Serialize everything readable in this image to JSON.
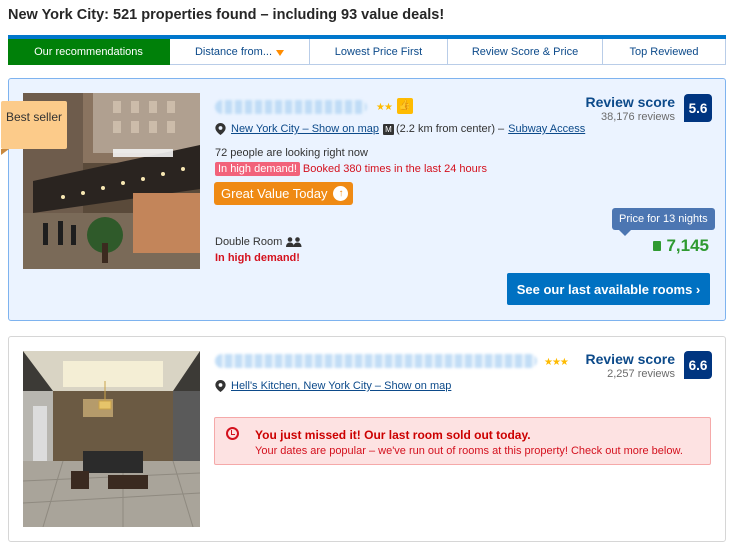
{
  "heading": "New York City: 521 properties found – including 93 value deals!",
  "sort_tabs": [
    {
      "label": "Our recommendations",
      "active": true
    },
    {
      "label": "Distance from...",
      "active": false
    },
    {
      "label": "Lowest Price First",
      "active": false
    },
    {
      "label": "Review Score & Price",
      "active": false
    },
    {
      "label": "Top Reviewed",
      "active": false
    }
  ],
  "hotel1": {
    "badge": "Best seller",
    "stars": "★★",
    "location_link": "New York City – Show on map",
    "distance": "(2.2 km from center) –",
    "subway": "Subway Access",
    "looking": "72 people are looking right now",
    "demand_pill": "In high demand!",
    "booked": "Booked 380 times in the last 24 hours",
    "great_value": "Great Value Today",
    "room_type": "Double Room",
    "room_demand": "In high demand!",
    "review_label": "Review score",
    "review_count": "38,176 reviews",
    "score": "5.6",
    "price_tip": "Price for 13 nights",
    "price": "7,145",
    "cta": "See our last available rooms ›",
    "colors": {
      "card_bg": "#ebf3ff",
      "cta": "#0071c2",
      "price": "#2f9a31"
    }
  },
  "hotel2": {
    "stars": "★★★",
    "location_link": "Hell's Kitchen, New York City – Show on map",
    "review_label": "Review score",
    "review_count": "2,257 reviews",
    "score": "6.6",
    "soldout_title": "You just missed it! Our last room sold out today.",
    "soldout_text": "Your dates are popular – we've run out of rooms at this property! Check out more below."
  },
  "colors": {
    "accent": "#0077cc",
    "active_tab": "#008009",
    "score_bg": "#003580"
  }
}
